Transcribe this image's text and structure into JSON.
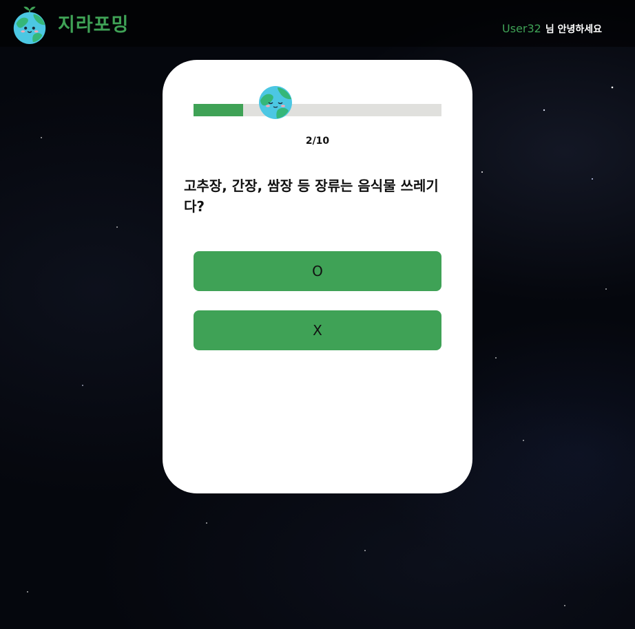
{
  "header": {
    "logo_text": "지라포밍",
    "logo_icon": "earth-mascot-icon",
    "greeting_username": "User32",
    "greeting_suffix": "님 안녕하세요"
  },
  "quiz": {
    "progress_current": 2,
    "progress_total": 10,
    "progress_label": "2/10",
    "progress_icon": "earth-mascot-icon",
    "question": "고추장, 간장, 쌈장 등 장류는 음식물 쓰레기다?",
    "options": [
      "O",
      "X"
    ]
  },
  "colors": {
    "brand_green": "#3fa256",
    "card_bg": "#ffffff",
    "track_bg": "#e0e0dd",
    "earth_blue": "#4cc7e3",
    "earth_green": "#35b779"
  }
}
